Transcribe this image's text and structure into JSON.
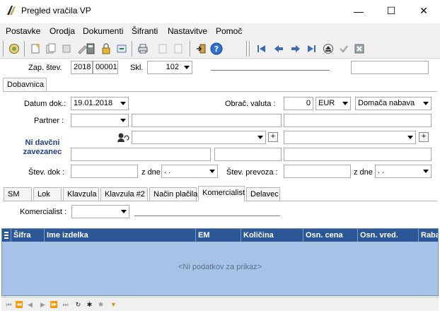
{
  "window": {
    "title": "Pregled vračila VP",
    "minimize": "—",
    "maximize": "☐",
    "close": "✕"
  },
  "menu": [
    "Postavke",
    "Orodja",
    "Dokumenti",
    "Šifranti",
    "Nastavitve",
    "Pomoč"
  ],
  "header": {
    "zap_label": "Zap. štev.",
    "zap_year": "2018",
    "zap_number": "00001",
    "skl_label": "Skl.",
    "skl_value": "102"
  },
  "main_tab": "Dobavnica",
  "form": {
    "datum_label": "Datum dok.:",
    "datum_value": "19.01.2018",
    "valuta_label": "Obrač. valuta :",
    "valuta_amount": "0",
    "valuta_currency": "EUR",
    "nabava_value": "Domača nabava",
    "partner_label": "Partner :",
    "ni_davcni_line1": "Ni davčni",
    "ni_davcni_line2": "zavezanec",
    "stev_dok_label": "Štev. dok :",
    "z_dne_label": "z dne",
    "date_placeholder": ". .",
    "stev_prevoza_label": "Štev. prevoza :",
    "z_dne2_label": "z dne",
    "date2_placeholder": ". ."
  },
  "sub_tabs": [
    "SM",
    "Lok",
    "Klavzula",
    "Klavzula #2",
    "Način plačila",
    "Komercialist",
    "Delavec"
  ],
  "active_sub_tab": "Komercialist",
  "komercialist": {
    "label": "Komercialist :"
  },
  "grid": {
    "columns": [
      "Šifra",
      "Ime izdelka",
      "EM",
      "Količina",
      "Osn. cena",
      "Osn. vred.",
      "Raba"
    ],
    "empty_text": "<Ni podatkov za prikaz>"
  },
  "colors": {
    "grid_header": "#2b5797",
    "grid_body": "#a6c2e6",
    "ni_davcni": "#1f3b8a"
  }
}
